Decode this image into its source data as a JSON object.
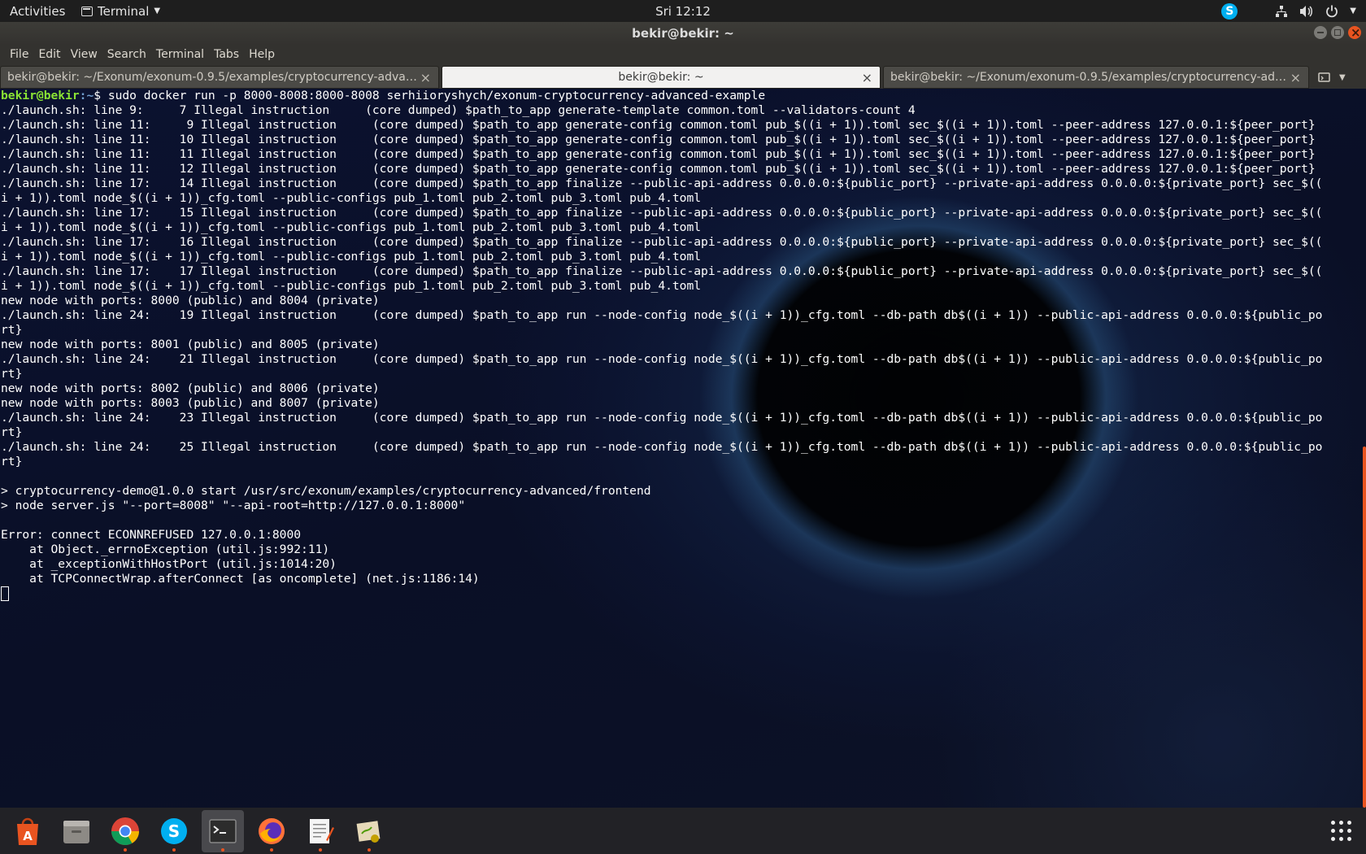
{
  "topbar": {
    "activities": "Activities",
    "app_menu": "Terminal",
    "clock": "Sri 12:12"
  },
  "window": {
    "title": "bekir@bekir: ~"
  },
  "menubar": [
    "File",
    "Edit",
    "View",
    "Search",
    "Terminal",
    "Tabs",
    "Help"
  ],
  "tabs": [
    {
      "label": "bekir@bekir: ~/Exonum/exonum-0.9.5/examples/cryptocurrency-advanc...",
      "active": false
    },
    {
      "label": "bekir@bekir: ~",
      "active": true
    },
    {
      "label": "bekir@bekir: ~/Exonum/exonum-0.9.5/examples/cryptocurrency-advanc...",
      "active": false
    }
  ],
  "terminal": {
    "prompt_user": "bekir@bekir",
    "prompt_path": ":~",
    "prompt_symbol": "$ ",
    "command": "sudo docker run -p 8000-8008:8000-8008 serhiioryshych/exonum-cryptocurrency-advanced-example",
    "output": "./launch.sh: line 9:     7 Illegal instruction     (core dumped) $path_to_app generate-template common.toml --validators-count 4\n./launch.sh: line 11:     9 Illegal instruction     (core dumped) $path_to_app generate-config common.toml pub_$((i + 1)).toml sec_$((i + 1)).toml --peer-address 127.0.0.1:${peer_port}\n./launch.sh: line 11:    10 Illegal instruction     (core dumped) $path_to_app generate-config common.toml pub_$((i + 1)).toml sec_$((i + 1)).toml --peer-address 127.0.0.1:${peer_port}\n./launch.sh: line 11:    11 Illegal instruction     (core dumped) $path_to_app generate-config common.toml pub_$((i + 1)).toml sec_$((i + 1)).toml --peer-address 127.0.0.1:${peer_port}\n./launch.sh: line 11:    12 Illegal instruction     (core dumped) $path_to_app generate-config common.toml pub_$((i + 1)).toml sec_$((i + 1)).toml --peer-address 127.0.0.1:${peer_port}\n./launch.sh: line 17:    14 Illegal instruction     (core dumped) $path_to_app finalize --public-api-address 0.0.0.0:${public_port} --private-api-address 0.0.0.0:${private_port} sec_$((\ni + 1)).toml node_$((i + 1))_cfg.toml --public-configs pub_1.toml pub_2.toml pub_3.toml pub_4.toml\n./launch.sh: line 17:    15 Illegal instruction     (core dumped) $path_to_app finalize --public-api-address 0.0.0.0:${public_port} --private-api-address 0.0.0.0:${private_port} sec_$((\ni + 1)).toml node_$((i + 1))_cfg.toml --public-configs pub_1.toml pub_2.toml pub_3.toml pub_4.toml\n./launch.sh: line 17:    16 Illegal instruction     (core dumped) $path_to_app finalize --public-api-address 0.0.0.0:${public_port} --private-api-address 0.0.0.0:${private_port} sec_$((\ni + 1)).toml node_$((i + 1))_cfg.toml --public-configs pub_1.toml pub_2.toml pub_3.toml pub_4.toml\n./launch.sh: line 17:    17 Illegal instruction     (core dumped) $path_to_app finalize --public-api-address 0.0.0.0:${public_port} --private-api-address 0.0.0.0:${private_port} sec_$((\ni + 1)).toml node_$((i + 1))_cfg.toml --public-configs pub_1.toml pub_2.toml pub_3.toml pub_4.toml\nnew node with ports: 8000 (public) and 8004 (private)\n./launch.sh: line 24:    19 Illegal instruction     (core dumped) $path_to_app run --node-config node_$((i + 1))_cfg.toml --db-path db$((i + 1)) --public-api-address 0.0.0.0:${public_po\nrt}\nnew node with ports: 8001 (public) and 8005 (private)\n./launch.sh: line 24:    21 Illegal instruction     (core dumped) $path_to_app run --node-config node_$((i + 1))_cfg.toml --db-path db$((i + 1)) --public-api-address 0.0.0.0:${public_po\nrt}\nnew node with ports: 8002 (public) and 8006 (private)\nnew node with ports: 8003 (public) and 8007 (private)\n./launch.sh: line 24:    23 Illegal instruction     (core dumped) $path_to_app run --node-config node_$((i + 1))_cfg.toml --db-path db$((i + 1)) --public-api-address 0.0.0.0:${public_po\nrt}\n./launch.sh: line 24:    25 Illegal instruction     (core dumped) $path_to_app run --node-config node_$((i + 1))_cfg.toml --db-path db$((i + 1)) --public-api-address 0.0.0.0:${public_po\nrt}\n\n> cryptocurrency-demo@1.0.0 start /usr/src/exonum/examples/cryptocurrency-advanced/frontend\n> node server.js \"--port=8008\" \"--api-root=http://127.0.0.1:8000\"\n\nError: connect ECONNREFUSED 127.0.0.1:8000\n    at Object._errnoException (util.js:992:11)\n    at _exceptionWithHostPort (util.js:1014:20)\n    at TCPConnectWrap.afterConnect [as oncomplete] (net.js:1186:14)\n"
  },
  "dock": {
    "items": [
      {
        "name": "software-center-icon",
        "color": "#e95420",
        "running": false
      },
      {
        "name": "files-icon",
        "color": "#9a9996",
        "running": false
      },
      {
        "name": "chrome-icon",
        "color": "#db4437",
        "running": true
      },
      {
        "name": "skype-icon",
        "color": "#00aff0",
        "running": true
      },
      {
        "name": "terminal-icon",
        "color": "#2c2c2c",
        "running": true
      },
      {
        "name": "firefox-icon",
        "color": "#ff7139",
        "running": true
      },
      {
        "name": "text-editor-icon",
        "color": "#f5f5f5",
        "running": true
      },
      {
        "name": "gedit-draw-icon",
        "color": "#e6d9b8",
        "running": true
      }
    ]
  },
  "colors": {
    "accent": "#e95420",
    "prompt_user": "#8ae234",
    "prompt_path": "#729fcf"
  }
}
